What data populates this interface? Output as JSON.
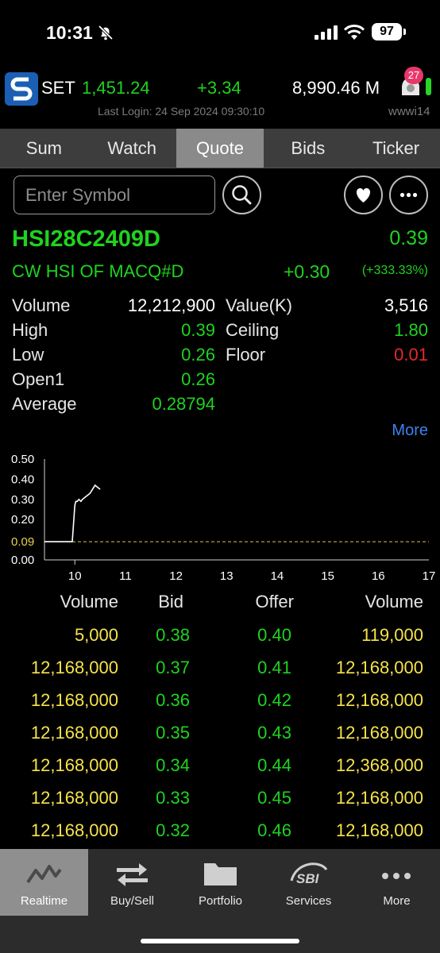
{
  "status_bar": {
    "time": "10:31",
    "battery": "97",
    "icons": [
      "bell-off-icon",
      "signal-icon",
      "wifi-icon",
      "battery-icon"
    ]
  },
  "market": {
    "logo_icon": "set-logo-icon",
    "index_name": "SET",
    "index_value": "1,451.24",
    "change": "+3.34",
    "value": "8,990.46 M",
    "notification_count": "27",
    "last_login": "Last Login: 24 Sep 2024 09:30:10",
    "username": "wwwi14"
  },
  "tabs": [
    {
      "label": "Sum",
      "active": false
    },
    {
      "label": "Watch",
      "active": false
    },
    {
      "label": "Quote",
      "active": true
    },
    {
      "label": "Bids",
      "active": false
    },
    {
      "label": "Ticker",
      "active": false
    }
  ],
  "search": {
    "placeholder": "Enter Symbol",
    "value": ""
  },
  "quote": {
    "symbol": "HSI28C2409D",
    "name": "CW HSI OF MACQ#D",
    "last": "0.39",
    "change": "+0.30",
    "change_pct": "(+333.33%)",
    "color_up": "#1fd31f",
    "color_down": "#e8282b"
  },
  "stats": {
    "volume_label": "Volume",
    "volume": "12,212,900",
    "high_label": "High",
    "high": "0.39",
    "low_label": "Low",
    "low": "0.26",
    "open1_label": "Open1",
    "open1": "0.26",
    "average_label": "Average",
    "average": "0.28794",
    "value_label": "Value(K)",
    "value": "3,516",
    "ceiling_label": "Ceiling",
    "ceiling": "1.80",
    "floor_label": "Floor",
    "floor": "0.01",
    "more_label": "More"
  },
  "chart_data": {
    "type": "line",
    "y_ticks": [
      "0.50",
      "0.40",
      "0.30",
      "0.20",
      "0.09",
      "0.00"
    ],
    "ylim": [
      0,
      0.5
    ],
    "x_ticks": [
      "10",
      "11",
      "12",
      "13",
      "14",
      "15",
      "16",
      "17"
    ],
    "xlim": [
      9.4,
      17
    ],
    "prior_close": 0.09,
    "series": [
      {
        "x": [
          9.4,
          9.95,
          10.0,
          10.02,
          10.05,
          10.08,
          10.12,
          10.15,
          10.2,
          10.25,
          10.3,
          10.35,
          10.4,
          10.45,
          10.5
        ],
        "values": [
          0.09,
          0.09,
          0.27,
          0.29,
          0.29,
          0.3,
          0.29,
          0.3,
          0.31,
          0.32,
          0.33,
          0.35,
          0.37,
          0.36,
          0.35
        ]
      }
    ],
    "grid": false
  },
  "bids": {
    "headers": [
      "Volume",
      "Bid",
      "Offer",
      "Volume"
    ],
    "rows": [
      {
        "bid_volume": "5,000",
        "bid": "0.38",
        "offer": "0.40",
        "offer_volume": "119,000"
      },
      {
        "bid_volume": "12,168,000",
        "bid": "0.37",
        "offer": "0.41",
        "offer_volume": "12,168,000"
      },
      {
        "bid_volume": "12,168,000",
        "bid": "0.36",
        "offer": "0.42",
        "offer_volume": "12,168,000"
      },
      {
        "bid_volume": "12,168,000",
        "bid": "0.35",
        "offer": "0.43",
        "offer_volume": "12,168,000"
      },
      {
        "bid_volume": "12,168,000",
        "bid": "0.34",
        "offer": "0.44",
        "offer_volume": "12,368,000"
      },
      {
        "bid_volume": "12,168,000",
        "bid": "0.33",
        "offer": "0.45",
        "offer_volume": "12,168,000"
      },
      {
        "bid_volume": "12,168,000",
        "bid": "0.32",
        "offer": "0.46",
        "offer_volume": "12,168,000"
      }
    ],
    "volume_color": "#f6e34a",
    "price_color": "#1fd31f"
  },
  "bottom_nav": [
    {
      "label": "Realtime",
      "icon": "realtime-chart-icon",
      "active": true
    },
    {
      "label": "Buy/Sell",
      "icon": "buy-sell-arrows-icon",
      "active": false
    },
    {
      "label": "Portfolio",
      "icon": "folder-icon",
      "active": false
    },
    {
      "label": "Services",
      "icon": "sbi-logo-icon",
      "active": false
    },
    {
      "label": "More",
      "icon": "more-dots-icon",
      "active": false
    }
  ]
}
